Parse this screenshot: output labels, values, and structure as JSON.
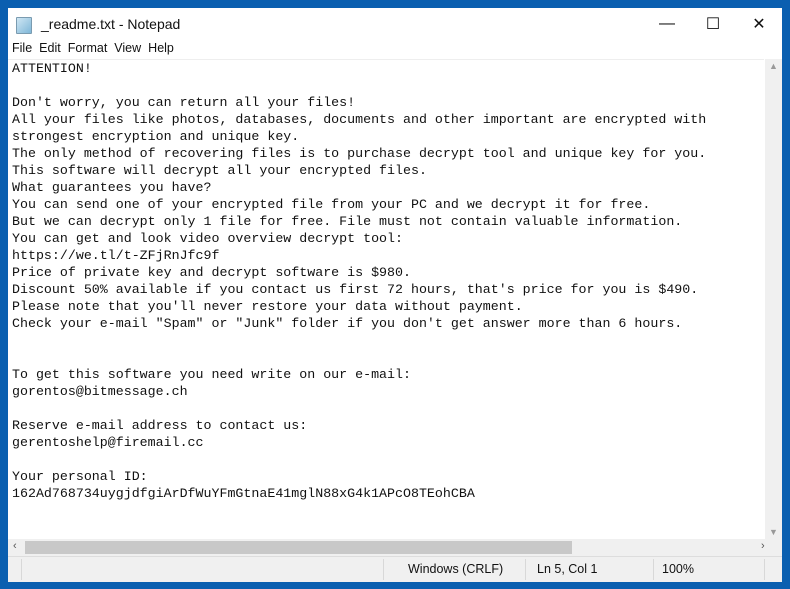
{
  "window": {
    "title": "_readme.txt - Notepad",
    "icon": "notepad-icon"
  },
  "controls": {
    "minimize": "—",
    "maximize": "☐",
    "close": "✕"
  },
  "menu": [
    "File",
    "Edit",
    "Format",
    "View",
    "Help"
  ],
  "document": {
    "lines": [
      "ATTENTION!",
      "",
      "Don't worry, you can return all your files!",
      "All your files like photos, databases, documents and other important are encrypted with",
      "strongest encryption and unique key.",
      "The only method of recovering files is to purchase decrypt tool and unique key for you.",
      "This software will decrypt all your encrypted files.",
      "What guarantees you have?",
      "You can send one of your encrypted file from your PC and we decrypt it for free.",
      "But we can decrypt only 1 file for free. File must not contain valuable information.",
      "You can get and look video overview decrypt tool:",
      "https://we.tl/t-ZFjRnJfc9f",
      "Price of private key and decrypt software is $980.",
      "Discount 50% available if you contact us first 72 hours, that's price for you is $490.",
      "Please note that you'll never restore your data without payment.",
      "Check your e-mail \"Spam\" or \"Junk\" folder if you don't get answer more than 6 hours.",
      "",
      "",
      "To get this software you need write on our e-mail:",
      "gorentos@bitmessage.ch",
      "",
      "Reserve e-mail address to contact us:",
      "gerentoshelp@firemail.cc",
      "",
      "Your personal ID:",
      "162Ad768734uygjdfgiArDfWuYFmGtnaE41mglN88xG4k1APcO8TEohCBA"
    ]
  },
  "status": {
    "line_ending": "Windows (CRLF)",
    "position": "Ln 5, Col 1",
    "zoom": "100%"
  },
  "colors": {
    "frame": "#0a5fb0",
    "background": "#ffffff",
    "statusbar": "#f0f0f0"
  }
}
